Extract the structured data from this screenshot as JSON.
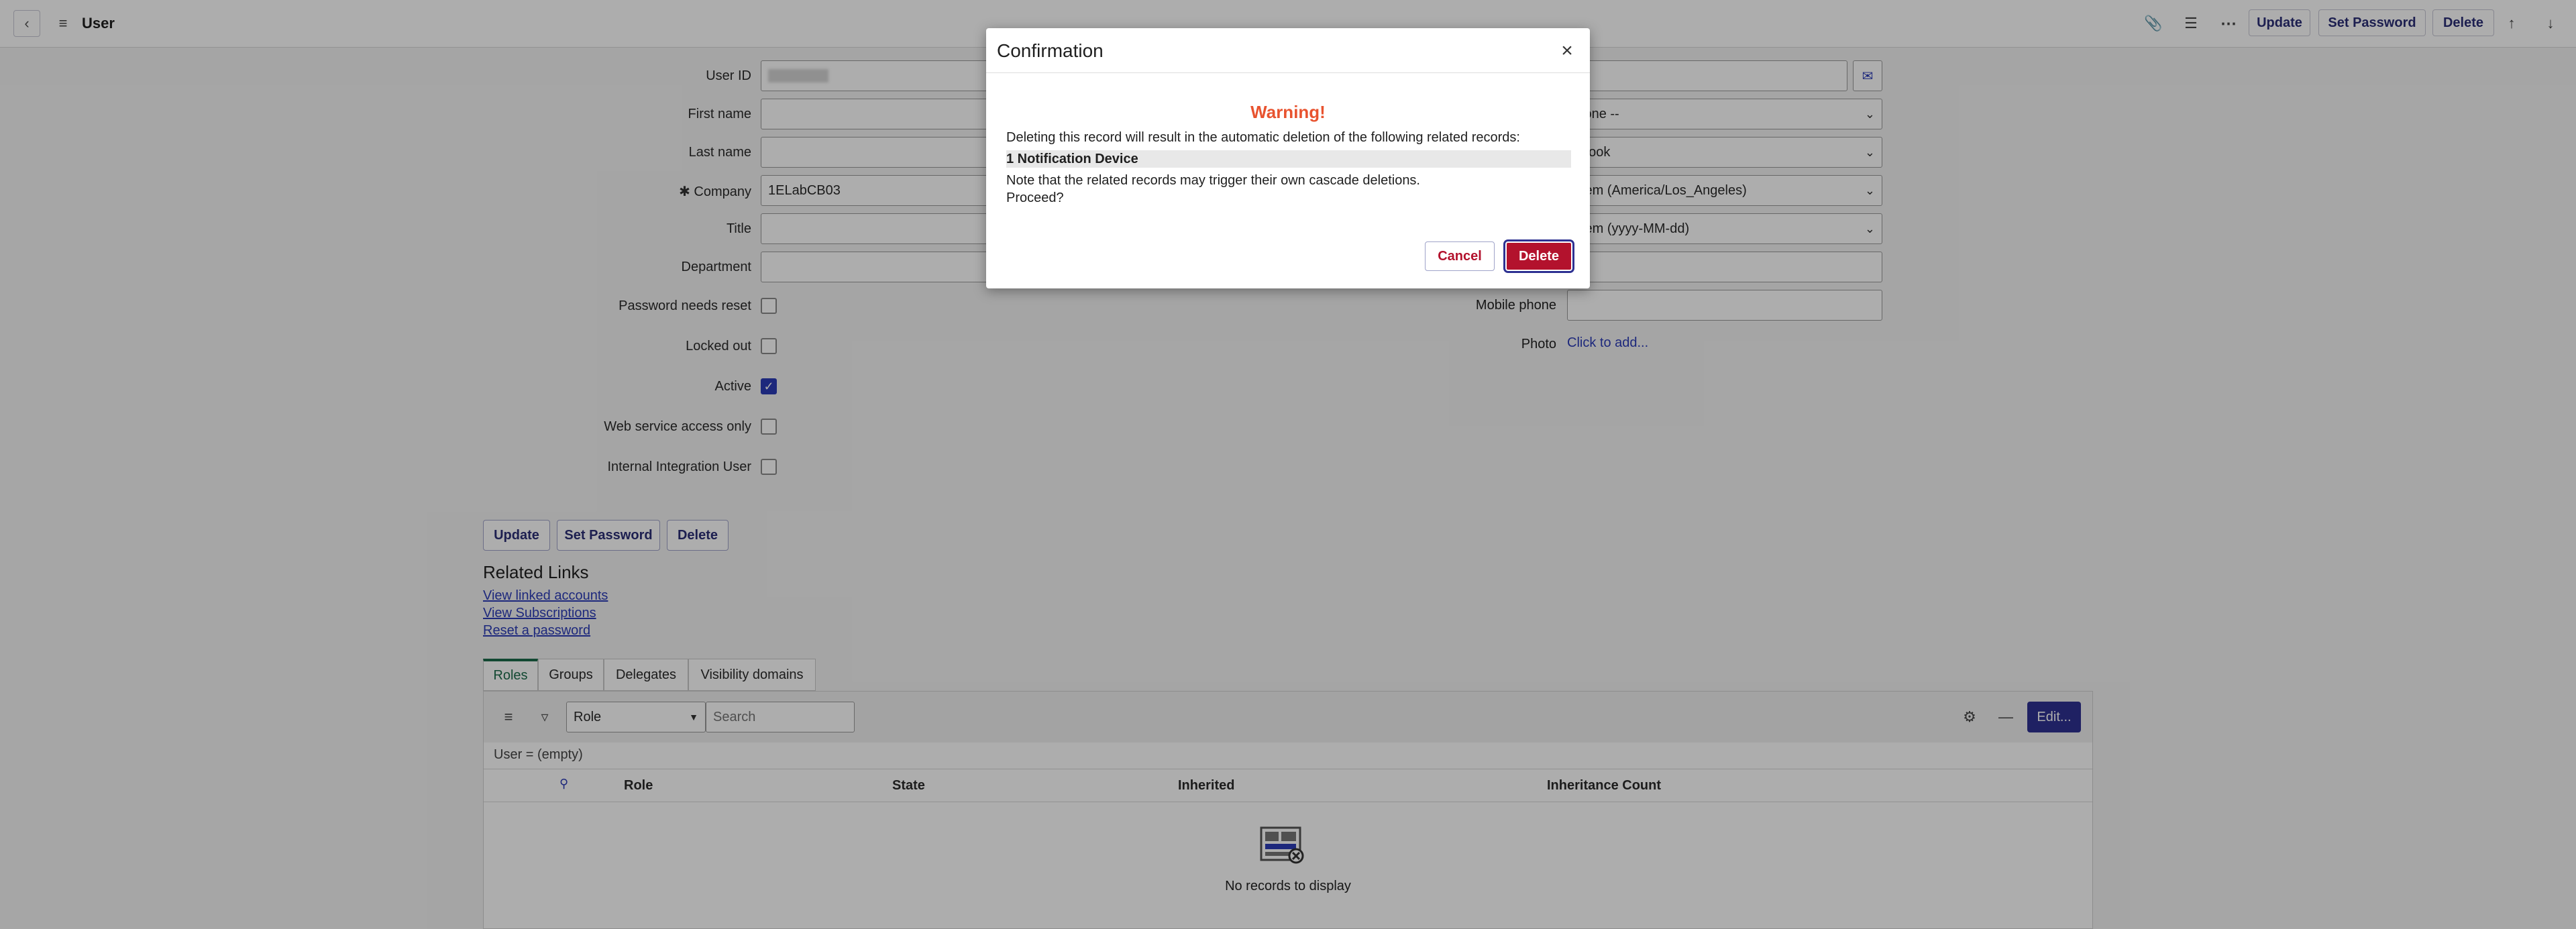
{
  "header": {
    "title": "User",
    "buttons": {
      "update": "Update",
      "set_password": "Set Password",
      "delete": "Delete"
    }
  },
  "form": {
    "left": {
      "user_id_label": "User ID",
      "first_name_label": "First name",
      "last_name_label": "Last name",
      "company_label": "Company",
      "company_value": "1ELabCB03",
      "title_label": "Title",
      "department_label": "Department",
      "password_reset_label": "Password needs reset",
      "locked_out_label": "Locked out",
      "active_label": "Active",
      "web_service_label": "Web service access only",
      "integration_user_label": "Internal Integration User"
    },
    "right": {
      "select1": "None --",
      "select2": "utlook",
      "select3": "stem (America/Los_Angeles)",
      "select4": "stem (yyyy-MM-dd)",
      "mobile_phone_label": "Mobile phone",
      "photo_label": "Photo",
      "photo_link": "Click to add..."
    },
    "checkboxes": {
      "password_reset": false,
      "locked_out": false,
      "active": true,
      "web_service": false,
      "integration_user": false
    }
  },
  "bottom_buttons": {
    "update": "Update",
    "set_password": "Set Password",
    "delete": "Delete"
  },
  "related_links": {
    "heading": "Related Links",
    "items": [
      "View linked accounts",
      "View Subscriptions",
      "Reset a password"
    ]
  },
  "tabs": [
    "Roles",
    "Groups",
    "Delegates",
    "Visibility domains"
  ],
  "list": {
    "filter_select": "Role",
    "search_placeholder": "Search",
    "edit_button": "Edit...",
    "breadcrumb": "User = (empty)",
    "columns": [
      "Role",
      "State",
      "Inherited",
      "Inheritance Count"
    ],
    "empty_message": "No records to display"
  },
  "modal": {
    "title": "Confirmation",
    "warning": "Warning!",
    "message": "Deleting this record will result in the automatic deletion of the following related records:",
    "related_record": "1 Notification Device",
    "note": "Note that the related records may trigger their own cascade deletions.",
    "proceed": "Proceed?",
    "cancel_label": "Cancel",
    "delete_label": "Delete"
  },
  "colors": {
    "accent": "#2b3bb7",
    "danger": "#b3122d",
    "warning": "#e8532f",
    "primary_button": "#2e3192"
  }
}
